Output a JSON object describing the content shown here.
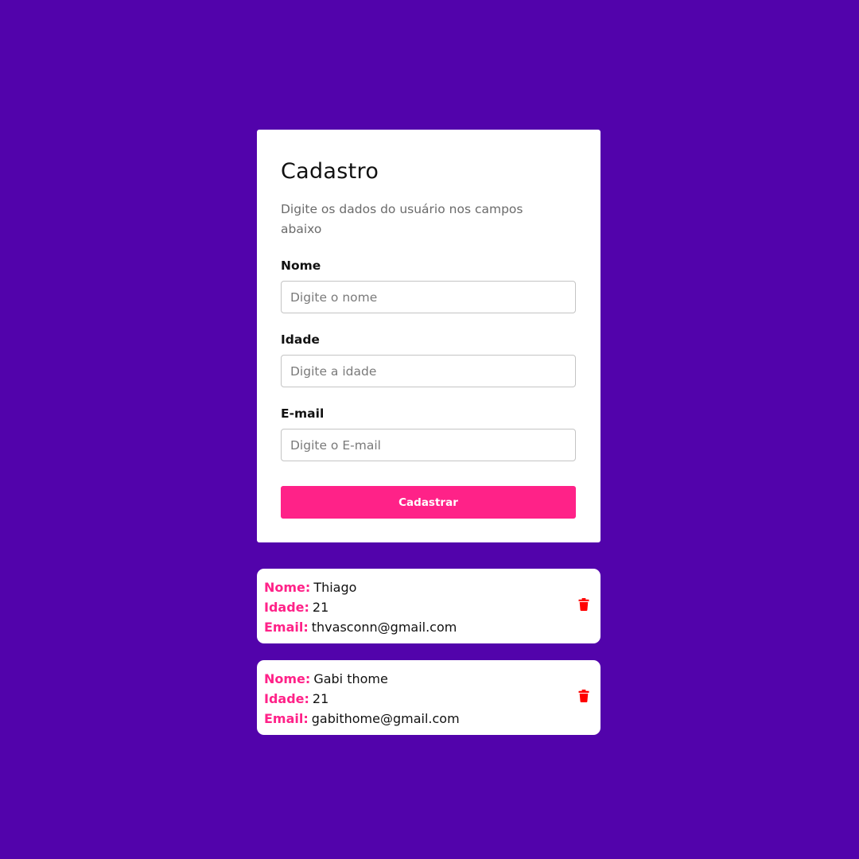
{
  "form": {
    "title": "Cadastro",
    "subtitle": "Digite os dados do usuário nos campos abaixo",
    "fields": {
      "name": {
        "label": "Nome",
        "placeholder": "Digite o nome"
      },
      "age": {
        "label": "Idade",
        "placeholder": "Digite a idade"
      },
      "email": {
        "label": "E-mail",
        "placeholder": "Digite o E-mail"
      }
    },
    "submit_label": "Cadastrar"
  },
  "users": [
    {
      "name_key": "Nome:",
      "name": "Thiago",
      "age_key": "Idade:",
      "age": "21",
      "email_key": "Email:",
      "email": "thvasconn@gmail.com",
      "delete_icon": "trash-icon"
    },
    {
      "name_key": "Nome:",
      "name": "Gabi thome",
      "age_key": "Idade:",
      "age": "21",
      "email_key": "Email:",
      "email": "gabithome@gmail.com",
      "delete_icon": "trash-icon"
    }
  ],
  "colors": {
    "background": "#5203ab",
    "accent": "#ff2288",
    "delete": "#ff0000"
  }
}
